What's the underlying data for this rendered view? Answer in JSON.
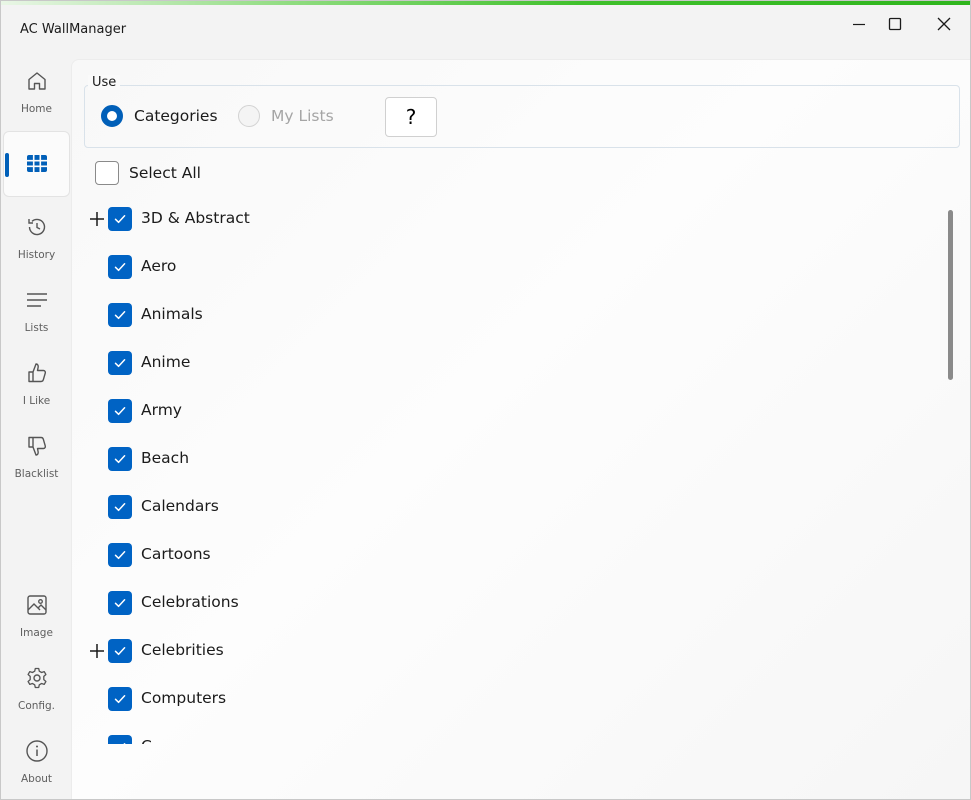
{
  "app": {
    "title": "AC WallManager"
  },
  "nav": {
    "items": [
      {
        "label": "Home",
        "icon": "home-icon"
      },
      {
        "label": "",
        "icon": "grid-icon",
        "active": true
      },
      {
        "label": "History",
        "icon": "history-icon"
      },
      {
        "label": "Lists",
        "icon": "lists-icon"
      },
      {
        "label": "I Like",
        "icon": "thumbs-up-icon"
      },
      {
        "label": "Blacklist",
        "icon": "thumbs-down-icon"
      },
      {
        "label": "Image",
        "icon": "image-icon"
      },
      {
        "label": "Config.",
        "icon": "gear-icon"
      },
      {
        "label": "About",
        "icon": "info-icon"
      }
    ]
  },
  "use": {
    "legend": "Use",
    "options": [
      {
        "label": "Categories",
        "selected": true,
        "enabled": true
      },
      {
        "label": "My Lists",
        "selected": false,
        "enabled": false
      }
    ],
    "help_label": "?"
  },
  "select_all": {
    "label": "Select All",
    "checked": false
  },
  "categories": [
    {
      "label": "3D & Abstract",
      "checked": true,
      "expandable": true
    },
    {
      "label": "Aero",
      "checked": true,
      "expandable": false
    },
    {
      "label": "Animals",
      "checked": true,
      "expandable": false
    },
    {
      "label": "Anime",
      "checked": true,
      "expandable": false
    },
    {
      "label": "Army",
      "checked": true,
      "expandable": false
    },
    {
      "label": "Beach",
      "checked": true,
      "expandable": false
    },
    {
      "label": "Calendars",
      "checked": true,
      "expandable": false
    },
    {
      "label": "Cartoons",
      "checked": true,
      "expandable": false
    },
    {
      "label": "Celebrations",
      "checked": true,
      "expandable": false
    },
    {
      "label": "Celebrities",
      "checked": true,
      "expandable": true
    },
    {
      "label": "Computers",
      "checked": true,
      "expandable": false
    },
    {
      "label": "C",
      "checked": true,
      "expandable": false
    }
  ],
  "colors": {
    "accent": "#005fb8",
    "checkbox": "#0063c4",
    "title_accent": "#3fc02b"
  }
}
